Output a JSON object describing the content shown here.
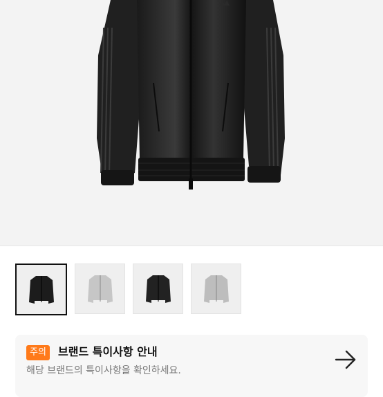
{
  "product_images": {
    "main_alt": "black track jacket",
    "thumbnails": [
      {
        "color": "black",
        "selected": true
      },
      {
        "color": "silver",
        "selected": false
      },
      {
        "color": "black",
        "selected": false
      },
      {
        "color": "silver",
        "selected": false
      }
    ]
  },
  "brand_notice": {
    "badge": "주의",
    "title": "브랜드 특이사항 안내",
    "description": "해당 브랜드의 특이사항을 확인하세요.",
    "arrow_icon": "arrow-right-icon",
    "badge_color": "#ff7a1a"
  }
}
